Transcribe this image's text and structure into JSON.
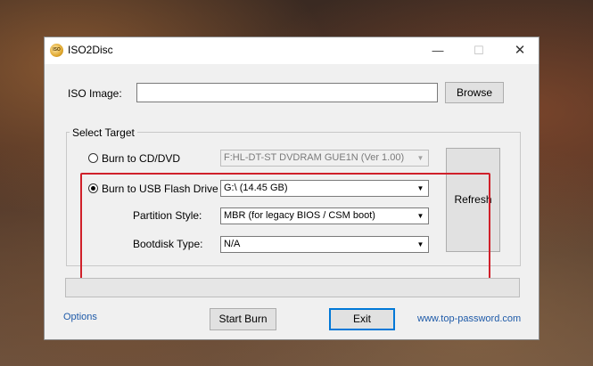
{
  "window": {
    "title": "ISO2Disc",
    "icon_text": "ISO",
    "controls": {
      "minimize": "—",
      "maximize": "☐",
      "close": "✕"
    }
  },
  "iso": {
    "label": "ISO Image:",
    "value": "",
    "browse_label": "Browse"
  },
  "target": {
    "group_label": "Select Target",
    "cd": {
      "label": "Burn to CD/DVD",
      "selected": false,
      "drive": "F:HL-DT-ST DVDRAM GUE1N (Ver 1.00)"
    },
    "usb": {
      "label": "Burn to USB Flash Drive",
      "selected": true,
      "drive": "G:\\ (14.45 GB)"
    },
    "partition": {
      "label": "Partition Style:",
      "value": "MBR (for legacy BIOS / CSM boot)"
    },
    "bootdisk": {
      "label": "Bootdisk Type:",
      "value": "N/A"
    },
    "refresh_label": "Refresh"
  },
  "progress": {
    "value": 0
  },
  "footer": {
    "options_label": "Options",
    "start_label": "Start Burn",
    "exit_label": "Exit",
    "website": "www.top-password.com"
  },
  "colors": {
    "highlight": "#d0202a",
    "link": "#1e5aa8",
    "focus": "#0078d7"
  }
}
